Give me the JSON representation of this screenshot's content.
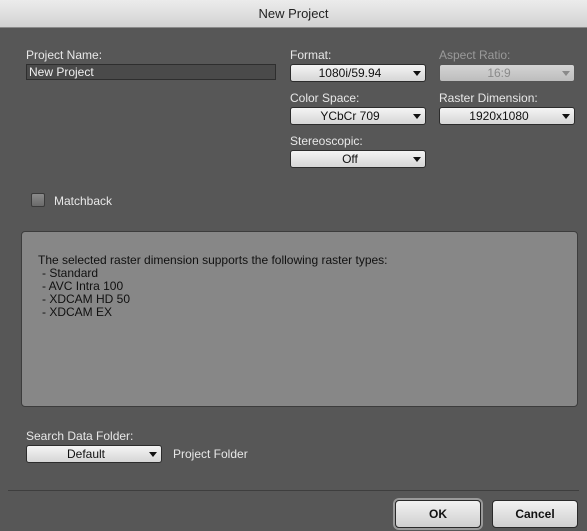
{
  "window": {
    "title": "New Project"
  },
  "project_name": {
    "label": "Project Name:",
    "value": "New Project"
  },
  "format": {
    "label": "Format:",
    "value": "1080i/59.94"
  },
  "aspect_ratio": {
    "label": "Aspect Ratio:",
    "value": "16:9",
    "enabled": false
  },
  "color_space": {
    "label": "Color Space:",
    "value": "YCbCr 709"
  },
  "raster_dimension": {
    "label": "Raster Dimension:",
    "value": "1920x1080"
  },
  "stereoscopic": {
    "label": "Stereoscopic:",
    "value": "Off"
  },
  "matchback": {
    "label": "Matchback",
    "checked": false
  },
  "info": {
    "heading": "The selected raster dimension supports the following raster types:",
    "items": [
      "- Standard",
      "- AVC Intra 100",
      "- XDCAM HD 50",
      "- XDCAM EX"
    ]
  },
  "search_data_folder": {
    "label": "Search Data Folder:",
    "value": "Default",
    "note": "Project Folder"
  },
  "buttons": {
    "ok": "OK",
    "cancel": "Cancel"
  },
  "icons": {
    "dropdown": "chevron-down-icon"
  }
}
